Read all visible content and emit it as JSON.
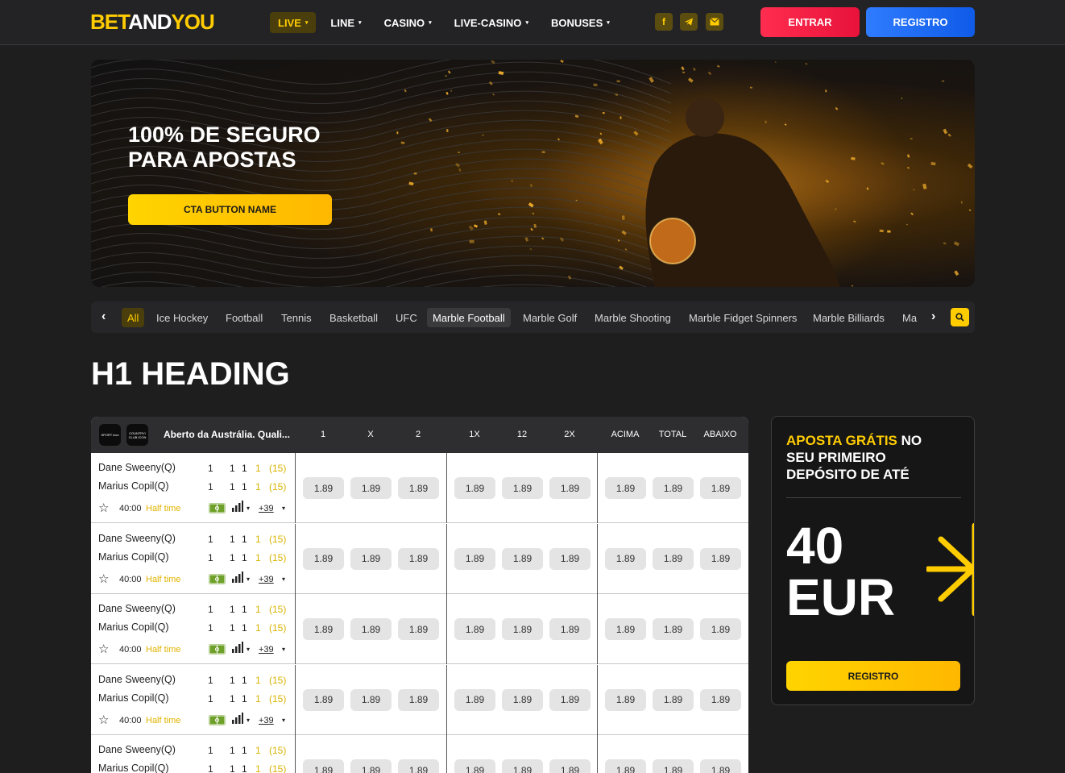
{
  "header": {
    "logo_bet": "BET",
    "logo_and": "AND",
    "logo_you": "YOU",
    "nav": [
      {
        "label": "LIVE",
        "active": true
      },
      {
        "label": "LINE"
      },
      {
        "label": "CASINO"
      },
      {
        "label": "LIVE-CASINO"
      },
      {
        "label": "BONUSES"
      }
    ],
    "social_icons": [
      "facebook-icon",
      "telegram-icon",
      "mail-icon"
    ],
    "entrar_label": "ENTRAR",
    "registro_label": "REGISTRO"
  },
  "banner": {
    "title_line1": "100% DE SEGURO",
    "title_line2": "PARA APOSTAS",
    "cta_label": "CTA BUTTON NAME"
  },
  "sports": {
    "items": [
      "All",
      "Ice Hockey",
      "Football",
      "Tennis",
      "Basketball",
      "UFC",
      "Marble Football",
      "Marble Golf",
      "Marble Shooting",
      "Marble Fidget Spinners",
      "Marble Billiards",
      "Ma"
    ],
    "selected": "Marble Football"
  },
  "page_title": "H1 HEADING",
  "table": {
    "sport_icon_label": "SPORT icon",
    "country_icon_label": "COUNTRY/ CLUB ICON",
    "league": "Aberto da Austrália. Quali...",
    "columns": [
      "1",
      "X",
      "2",
      "1X",
      "12",
      "2X",
      "ACIMA",
      "TOTAL",
      "ABAIXO"
    ],
    "rows": [
      {
        "p1": "Dane Sweeny(Q)",
        "p2": "Marius Copil(Q)",
        "s1": [
          "1",
          "1",
          "1",
          "1",
          "(15)"
        ],
        "s2": [
          "1",
          "1",
          "1",
          "1",
          "(15)"
        ],
        "time": "40:00",
        "status": "Half time",
        "more": "+39",
        "odds": [
          "1.89",
          "1.89",
          "1.89",
          "1.89",
          "1.89",
          "1.89",
          "1.89",
          "1.89",
          "1.89"
        ]
      },
      {
        "p1": "Dane Sweeny(Q)",
        "p2": "Marius Copil(Q)",
        "s1": [
          "1",
          "1",
          "1",
          "1",
          "(15)"
        ],
        "s2": [
          "1",
          "1",
          "1",
          "1",
          "(15)"
        ],
        "time": "40:00",
        "status": "Half time",
        "more": "+39",
        "odds": [
          "1.89",
          "1.89",
          "1.89",
          "1.89",
          "1.89",
          "1.89",
          "1.89",
          "1.89",
          "1.89"
        ]
      },
      {
        "p1": "Dane Sweeny(Q)",
        "p2": "Marius Copil(Q)",
        "s1": [
          "1",
          "1",
          "1",
          "1",
          "(15)"
        ],
        "s2": [
          "1",
          "1",
          "1",
          "1",
          "(15)"
        ],
        "time": "40:00",
        "status": "Half time",
        "more": "+39",
        "odds": [
          "1.89",
          "1.89",
          "1.89",
          "1.89",
          "1.89",
          "1.89",
          "1.89",
          "1.89",
          "1.89"
        ]
      },
      {
        "p1": "Dane Sweeny(Q)",
        "p2": "Marius Copil(Q)",
        "s1": [
          "1",
          "1",
          "1",
          "1",
          "(15)"
        ],
        "s2": [
          "1",
          "1",
          "1",
          "1",
          "(15)"
        ],
        "time": "40:00",
        "status": "Half time",
        "more": "+39",
        "odds": [
          "1.89",
          "1.89",
          "1.89",
          "1.89",
          "1.89",
          "1.89",
          "1.89",
          "1.89",
          "1.89"
        ]
      },
      {
        "p1": "Dane Sweeny(Q)",
        "p2": "Marius Copil(Q)",
        "s1": [
          "1",
          "1",
          "1",
          "1",
          "(15)"
        ],
        "s2": [
          "1",
          "1",
          "1",
          "1",
          "(15)"
        ],
        "time": "",
        "status": "",
        "more": "",
        "odds": [
          "1.89",
          "1.89",
          "1.89",
          "1.89",
          "1.89",
          "1.89",
          "1.89",
          "1.89",
          "1.89"
        ]
      }
    ]
  },
  "promo": {
    "title_yellow": "APOSTA GRÁTIS",
    "title_rest": " NO SEU PRIMEIRO DEPÓSITO DE ATÉ",
    "amount": "40",
    "currency": "EUR",
    "button_label": "REGISTRO"
  },
  "colors": {
    "accent": "#ffcc00",
    "entrar": "#f0183f",
    "registro": "#1565f0",
    "background": "#1e1e1f"
  }
}
